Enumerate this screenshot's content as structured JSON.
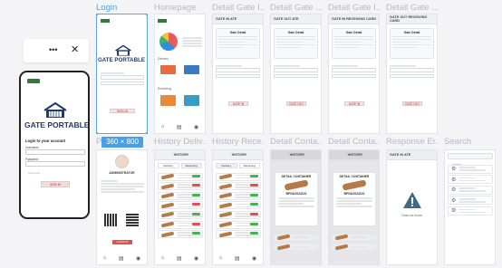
{
  "toolbar": {
    "more": "•••",
    "close": "✕"
  },
  "phone": {
    "brand": "GATE PORTABLE",
    "login_title": "Login to your account",
    "username_label": "Username",
    "username_placeholder": "Username",
    "password_label": "Password",
    "password_placeholder": "Password",
    "signin": "SIGN IN"
  },
  "size_badge": "360 × 800",
  "titles": {
    "login": "Login",
    "homepage": "Homepage",
    "detail1": "Detail Gate I...",
    "detail2": "Detail Gate ...",
    "detail3": "Detail Gate I...",
    "detail4": "Detail Gate ...",
    "profile": "P",
    "history_deliv": "History Deliv...",
    "history_rece": "History Rece...",
    "detail_conta1": "Detail Conta...",
    "detail_conta2": "Detail Conta...",
    "response": "Response Er...",
    "search": "Search"
  },
  "login_frame": {
    "brand": "GATE PORTABLE",
    "signin": "SIGN IN"
  },
  "home": {
    "section1": "Delivery",
    "section2": "Receiving"
  },
  "details": [
    {
      "header": "GATE IN ATE",
      "card_title": "Gate Detail",
      "btn": "GATE IN"
    },
    {
      "header": "GATE OUT ATE",
      "card_title": "Gate Detail",
      "btn": "GATE OUT"
    },
    {
      "header": "GATE IN RECEIVING CARD",
      "card_title": "Gate Detail",
      "btn": "GATE IN"
    },
    {
      "header": "GATE OUT RECEIVING CARD",
      "card_title": "Gate Detail",
      "btn": "GATE OUT"
    }
  ],
  "profile": {
    "name": "ADMINISTRATOR",
    "logout": "LOGOUT"
  },
  "history": {
    "title": "HISTORY",
    "tab1": "Delivery",
    "tab2": "Receiving",
    "search": "Search"
  },
  "container": {
    "title": "DETAIL CONTAINER",
    "code": "BPNU2023123"
  },
  "response": {
    "header": "GATE IN ATE",
    "message": "Data not found"
  },
  "search": {
    "placeholder": "Search"
  }
}
